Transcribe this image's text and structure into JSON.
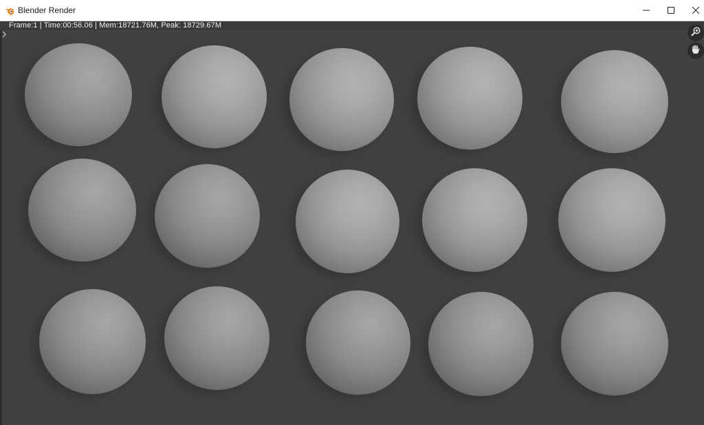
{
  "window": {
    "title": "Blender Render",
    "icon": "blender-logo-icon",
    "controls": [
      "minimize-icon",
      "maximize-icon",
      "close-icon"
    ]
  },
  "render": {
    "stats": "Frame:1 | Time:00:56.06 | Mem:18721.76M, Peak: 18729.67M",
    "nav_icons": [
      "zoom-icon",
      "hand-pan-icon"
    ],
    "sphere_grid": {
      "rows": 3,
      "columns": 5
    }
  },
  "colors": {
    "titlebar": "#ffffff",
    "background": "#414141",
    "accent_orange": "#e87d0d"
  }
}
